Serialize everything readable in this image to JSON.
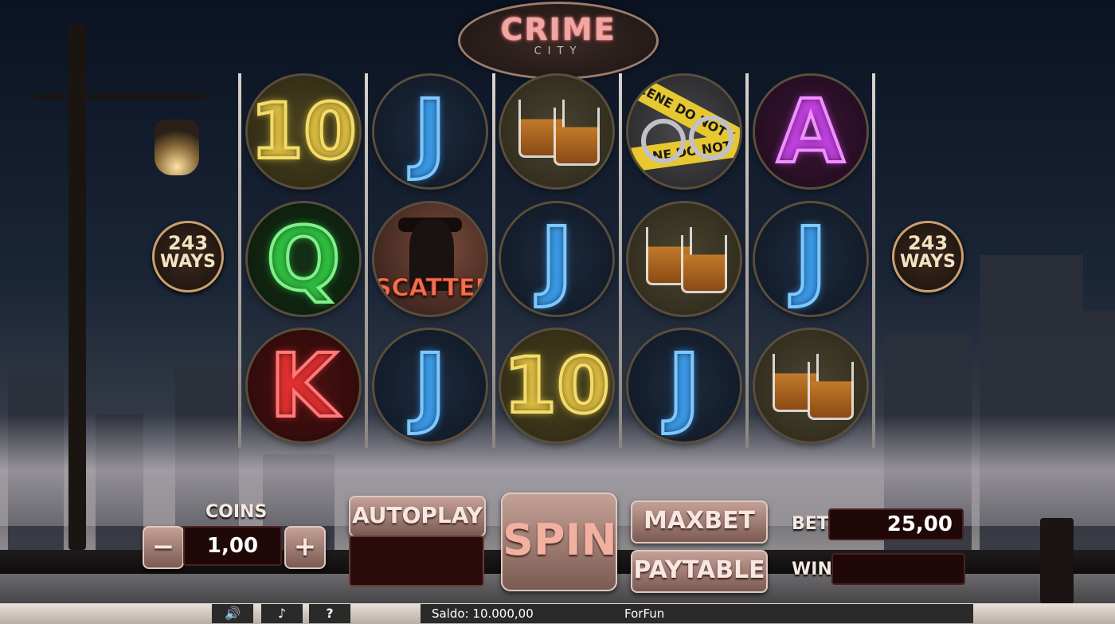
{
  "logo": {
    "title": "CRIME",
    "subtitle": "CITY"
  },
  "ways_left": {
    "number": "243",
    "label": "WAYS"
  },
  "ways_right": {
    "number": "243",
    "label": "WAYS"
  },
  "reels": [
    [
      "10",
      "Q",
      "K"
    ],
    [
      "J",
      "SCATTER",
      "J"
    ],
    [
      "whisky",
      "J",
      "10"
    ],
    [
      "crime-scene-cuffs",
      "whisky",
      "J"
    ],
    [
      "A",
      "J",
      "whisky"
    ]
  ],
  "symbols": {
    "scatter_label": "SCATTER",
    "tape_text_1": "SCENE DO NOT C",
    "tape_text_2": "NE DO NOT"
  },
  "controls": {
    "coins_label": "COINS",
    "coins_value": "1,00",
    "minus": "−",
    "plus": "+",
    "autoplay": "AUTOPLAY",
    "spin": "SPIN",
    "maxbet": "MAXBET",
    "paytable": "PAYTABLE",
    "bet_label": "BET",
    "bet_value": "25,00",
    "win_label": "WIN",
    "win_value": ""
  },
  "status_bar": {
    "sound_icon": "speaker-icon",
    "music_icon": "music-note-icon",
    "help_icon": "question-mark-icon",
    "balance": "Saldo: 10.000,00",
    "mode": "ForFun"
  }
}
